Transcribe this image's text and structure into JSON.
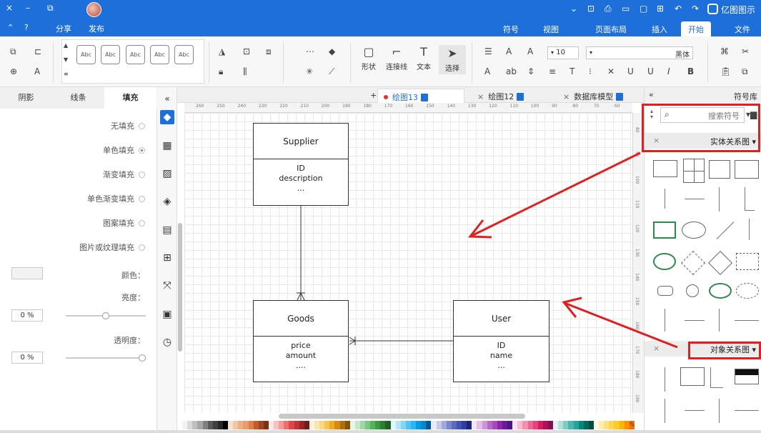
{
  "titlebar": {
    "app_name": "亿图图示",
    "close": "×",
    "minimize": "–",
    "restore": "⧉",
    "icons": [
      "chevron-down-icon",
      "screen-icon",
      "print-icon",
      "save-icon",
      "open-icon",
      "new-icon",
      "undo-icon",
      "redo-icon"
    ]
  },
  "menubar": {
    "collapse": "⌃",
    "help": "?",
    "share": "分享",
    "publish": "发布",
    "tabs": [
      "文件",
      "开始",
      "插入",
      "页面布局",
      "视图",
      "符号"
    ],
    "active_tab": "开始"
  },
  "ribbon": {
    "select_label": "选择",
    "text_label": "文本",
    "connector_label": "连接线",
    "shape_label": "形状",
    "font_name": "黑体",
    "font_size": "10",
    "style_boxes": [
      "Abc",
      "Abc",
      "Abc",
      "Abc",
      "Abc",
      "Abc"
    ]
  },
  "left_panel": {
    "tabs": [
      "填充",
      "线条",
      "阴影"
    ],
    "active_tab": "填充",
    "fill_options": [
      "无填充",
      "单色填充",
      "渐变填充",
      "单色渐变填充",
      "图案填充",
      "图片或纹理填充"
    ],
    "selected_fill": "单色填充",
    "color_label": "颜色：",
    "brightness_label": "亮度：",
    "transparency_label": "透明度：",
    "brightness_value": "0 %",
    "transparency_value": "0 %",
    "brightness_level": 0.5,
    "transparency_level": 0.0
  },
  "doc_tabs": [
    {
      "label": "数据库模型",
      "active": false
    },
    {
      "label": "绘图12",
      "active": false
    },
    {
      "label": "绘图13",
      "active": true
    }
  ],
  "add_tab": "+",
  "ruler_h": [
    "60",
    "70",
    "80",
    "90",
    "100",
    "110",
    "120",
    "130",
    "140",
    "150",
    "160",
    "170",
    "180",
    "190",
    "200",
    "210",
    "220",
    "230",
    "240",
    "250",
    "260"
  ],
  "ruler_v": [
    "80",
    "90",
    "100",
    "110",
    "120",
    "130",
    "140",
    "150",
    "160",
    "170",
    "180",
    "190"
  ],
  "entities": [
    {
      "name": "Supplier",
      "fields": [
        "ID",
        "description",
        "..."
      ]
    },
    {
      "name": "Goods",
      "fields": [
        "price",
        "amount",
        "...."
      ]
    },
    {
      "name": "User",
      "fields": [
        "ID",
        "name",
        "..."
      ]
    }
  ],
  "right_panel": {
    "title": "符号库",
    "expand": "«",
    "search_placeholder": "搜索符号",
    "sections": [
      "实体关系图",
      "对象关系图"
    ]
  },
  "colors": {
    "accent": "#1e6fd9",
    "annotation_red": "#e02020"
  },
  "palette": [
    "#ffffff",
    "#f2f2f2",
    "#d9d9d9",
    "#bfbfbf",
    "#a6a6a6",
    "#808080",
    "#595959",
    "#404040",
    "#262626",
    "#000000",
    "#f8e0d0",
    "#f4c6a2",
    "#eab184",
    "#e89b6b",
    "#e07b4c",
    "#c55a2b",
    "#a14422",
    "#7a3316",
    "#fde8e8",
    "#f9c0c0",
    "#f39a9a",
    "#ec6f6f",
    "#e04646",
    "#c43232",
    "#9c2525",
    "#741b1b",
    "#fdf3d8",
    "#fbe6b0",
    "#f8d780",
    "#f5c24f",
    "#f0a924",
    "#d88b10",
    "#b06f0a",
    "#875406",
    "#e8f5e9",
    "#c6e6c8",
    "#a2d6a5",
    "#7cc681",
    "#51b459",
    "#3a9a41",
    "#2d7d33",
    "#215f26",
    "#e1f5fe",
    "#b3e5fc",
    "#81d4fa",
    "#4fc3f7",
    "#29b6f6",
    "#039be5",
    "#0288d1",
    "#01579b",
    "#e8eaf6",
    "#c5cae9",
    "#9fa8da",
    "#7986cb",
    "#5c6bc0",
    "#3f51b5",
    "#303f9f",
    "#1a237e",
    "#f3e5f5",
    "#e1bee7",
    "#ce93d8",
    "#ba68c8",
    "#ab47bc",
    "#8e24aa",
    "#6a1b9a",
    "#4a148c",
    "#fce4ec",
    "#f8bbd0",
    "#f48fb1",
    "#f06292",
    "#ec407a",
    "#d81b60",
    "#ad1457",
    "#880e4f",
    "#e0f2f1",
    "#b2dfdb",
    "#80cbc4",
    "#4db6ac",
    "#26a69a",
    "#00897b",
    "#00695c",
    "#004d40",
    "#fff8e1",
    "#ffecb3",
    "#ffe082",
    "#ffd54f",
    "#ffca28",
    "#ffb300",
    "#ff8f00",
    "#ff6f00"
  ]
}
